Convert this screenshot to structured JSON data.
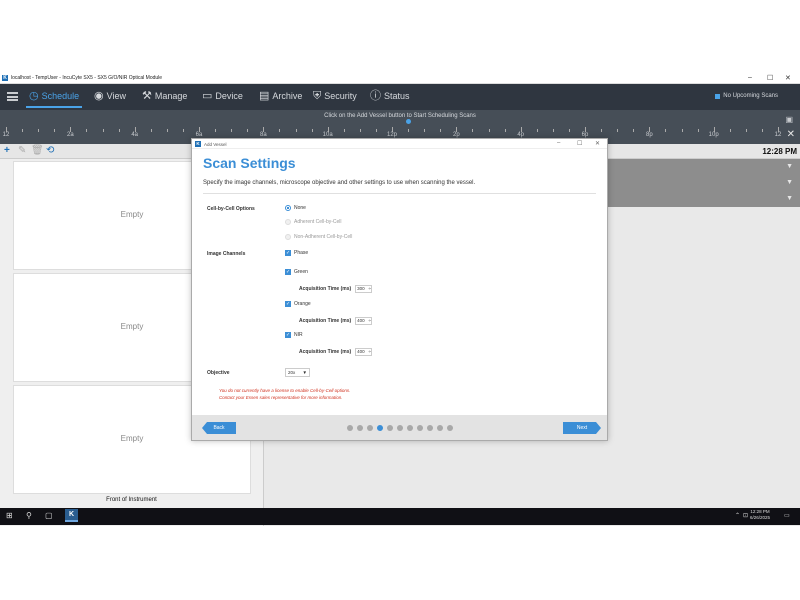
{
  "window": {
    "title": "localhost - TempUser - IncuCyte SX5 - SX5 G/O/NIR Optical Module",
    "icon_letter": "K",
    "controls": [
      "–",
      "☐",
      "✕"
    ]
  },
  "menu": {
    "items": [
      {
        "label": "Schedule",
        "icon": "clock-icon",
        "glyph": "◷"
      },
      {
        "label": "View",
        "icon": "eye-icon",
        "glyph": "◉"
      },
      {
        "label": "Manage",
        "icon": "wrench-icon",
        "glyph": "⚒"
      },
      {
        "label": "Device",
        "icon": "device-icon",
        "glyph": "▭"
      },
      {
        "label": "Archive",
        "icon": "archive-icon",
        "glyph": "▤"
      },
      {
        "label": "Security",
        "icon": "shield-icon",
        "glyph": "⛨"
      },
      {
        "label": "Status",
        "icon": "info-icon",
        "glyph": "ⓘ"
      }
    ],
    "upcoming": "No Upcoming Scans",
    "accent": "#4aa3e8"
  },
  "timeline": {
    "hint": "Click on the Add Vessel button to Start Scheduling Scans",
    "labels": [
      "12",
      "2a",
      "4a",
      "6a",
      "8a",
      "10a",
      "12p",
      "2p",
      "4p",
      "6p",
      "8p",
      "10p",
      "12"
    ]
  },
  "toolbar": {
    "add": "+",
    "clock": "12:28 PM"
  },
  "vessels": [
    "Empty",
    "Empty",
    "Empty"
  ],
  "front_label": "Front of Instrument",
  "dialog": {
    "window_title": "Add Vessel",
    "heading": "Scan Settings",
    "description": "Specify the image channels, microscope objective and other settings to use when scanning the vessel.",
    "cell_label": "Cell-by-Cell Options",
    "cell_options": [
      "None",
      "Adherent Cell-by-Cell",
      "Non-Adherent Cell-by-Cell"
    ],
    "channels_label": "Image Channels",
    "channels": {
      "phase": "Phase",
      "green": "Green",
      "orange": "Orange",
      "nir": "NIR"
    },
    "acq_label": "Acquisition Time (ms)",
    "acq_values": {
      "green": "300",
      "orange": "400",
      "nir": "400"
    },
    "objective_label": "Objective",
    "objective_value": "20x",
    "warning_line1": "You do not currently have a license to enable Cell-by-Cell options.",
    "warning_line2": "Contact your Essen sales representative for more information.",
    "back": "Back",
    "next": "Next",
    "step_total": 11,
    "step_current": 4
  },
  "taskbar": {
    "time": "12:28 PM",
    "date": "6/26/2025"
  }
}
